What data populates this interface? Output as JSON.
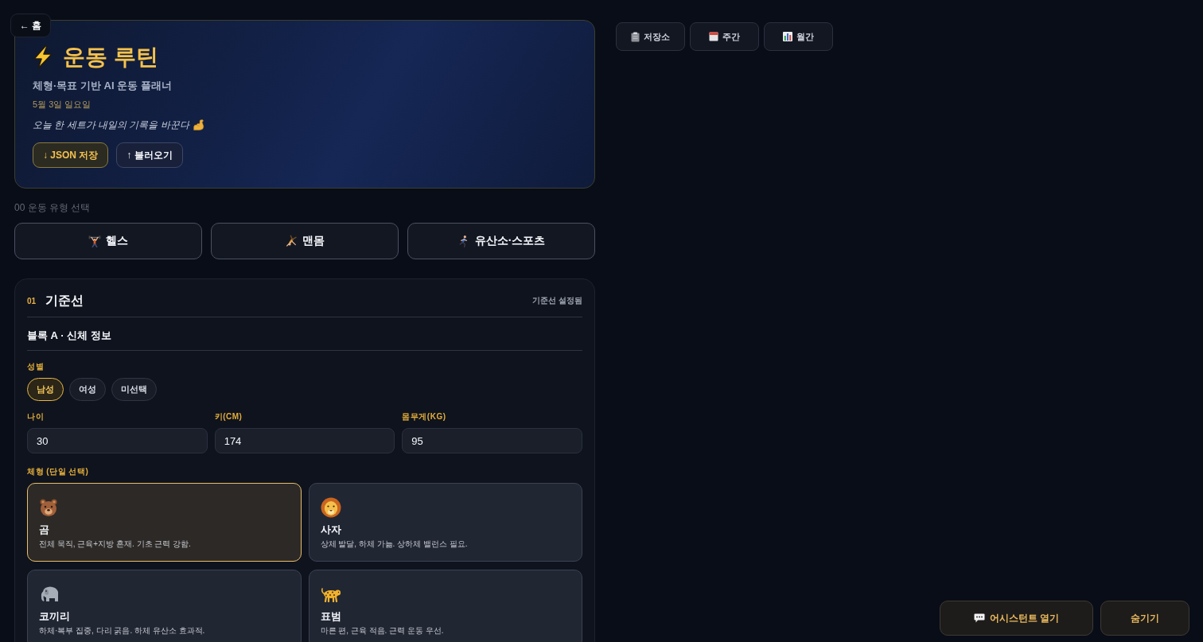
{
  "back_button": {
    "label": "← 홈"
  },
  "header": {
    "title": "운동 루틴",
    "subtitle": "체형·목표 기반 AI 운동 플래너",
    "date": "5월 3일 일요일",
    "quote": "오늘 한 세트가 내일의 기록을 바꾼다",
    "buttons": [
      {
        "label": "↓ JSON 저장",
        "kind": "primary"
      },
      {
        "label": "↑ 불러오기",
        "kind": "secondary"
      }
    ]
  },
  "toolbar": {
    "buttons": [
      {
        "label": "저장소"
      },
      {
        "label": "주간"
      },
      {
        "label": "월간"
      }
    ]
  },
  "exercise_type": {
    "label": "00 운동 유형 선택",
    "options": [
      {
        "label": "헬스",
        "selected": false
      },
      {
        "label": "맨몸",
        "selected": false
      },
      {
        "label": "유산소·스포츠",
        "selected": false
      }
    ]
  },
  "baseline": {
    "number": "01",
    "title": "기준선",
    "status": "기준선 설정됨",
    "block_title": "블록 A · 신체 정보",
    "sex": {
      "label": "성별",
      "options": [
        {
          "label": "남성",
          "selected": true
        },
        {
          "label": "여성",
          "selected": false
        },
        {
          "label": "미선택",
          "selected": false
        }
      ]
    },
    "fields": [
      {
        "label": "나이",
        "value": "30"
      },
      {
        "label": "키(CM)",
        "value": "174"
      },
      {
        "label": "몸무게(KG)",
        "value": "95"
      }
    ],
    "body_type": {
      "label": "체형 (단일 선택)",
      "options": [
        {
          "name": "곰",
          "description": "전체 묵직, 근육+지방 혼재. 기초 근력 강함.",
          "selected": true
        },
        {
          "name": "사자",
          "description": "상체 발달, 하체 가늚. 상하체 밸런스 필요.",
          "selected": false
        },
        {
          "name": "코끼리",
          "description": "하체·복부 집중, 다리 굵음. 하체 유산소 효과적.",
          "selected": false
        },
        {
          "name": "표범",
          "description": "마른 편, 근육 적음. 근력 운동 우선.",
          "selected": false
        }
      ]
    }
  },
  "assistant": {
    "buttons": [
      {
        "label": "어시스턴트 열기"
      },
      {
        "label": "숨기기"
      }
    ]
  }
}
